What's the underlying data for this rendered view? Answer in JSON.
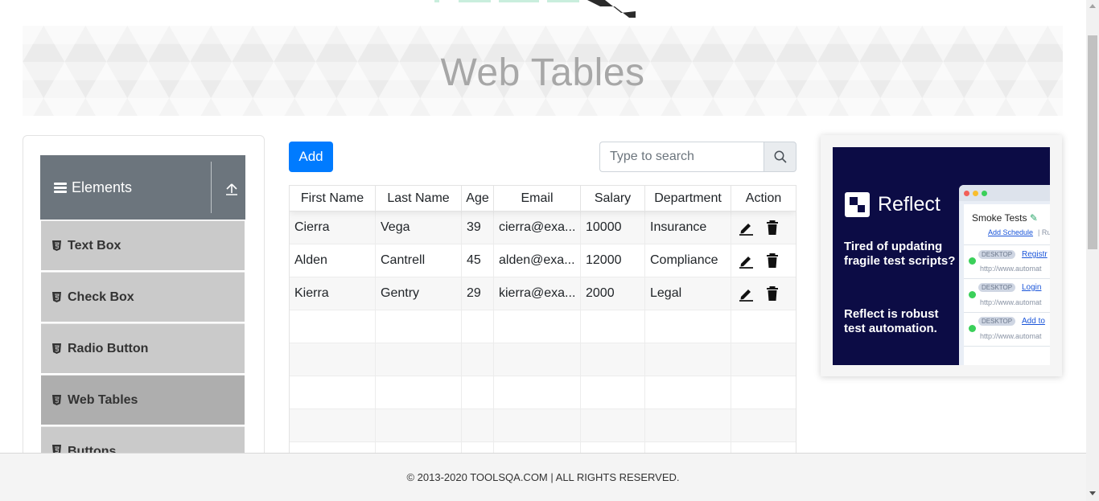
{
  "page": {
    "title": "Web Tables"
  },
  "sidebar": {
    "group_title": "Elements",
    "items": [
      {
        "label": "Text Box"
      },
      {
        "label": "Check Box"
      },
      {
        "label": "Radio Button"
      },
      {
        "label": "Web Tables",
        "active": true
      },
      {
        "label": "Buttons"
      }
    ]
  },
  "toolbar": {
    "add_label": "Add",
    "search_placeholder": "Type to search",
    "search_value": ""
  },
  "table": {
    "headers": [
      "First Name",
      "Last Name",
      "Age",
      "Email",
      "Salary",
      "Department",
      "Action"
    ],
    "rows": [
      {
        "first": "Cierra",
        "last": "Vega",
        "age": "39",
        "email": "cierra@exa...",
        "salary": "10000",
        "department": "Insurance"
      },
      {
        "first": "Alden",
        "last": "Cantrell",
        "age": "45",
        "email": "alden@exa...",
        "salary": "12000",
        "department": "Compliance"
      },
      {
        "first": "Kierra",
        "last": "Gentry",
        "age": "29",
        "email": "kierra@exa...",
        "salary": "2000",
        "department": "Legal"
      }
    ],
    "action_icons": [
      "edit-icon",
      "delete-icon"
    ]
  },
  "ad": {
    "brand": "Reflect",
    "tagline_1": "Tired of updating fragile test scripts?",
    "tagline_2": "Reflect is robust test automation.",
    "mock_title": "Smoke Tests",
    "mock_schedule": "Add Schedule",
    "mock_schedule_sep": "| Ru",
    "runs": [
      {
        "badge": "DESKTOP",
        "link": "Registr",
        "url": "http://www.automat"
      },
      {
        "badge": "DESKTOP",
        "link": "Login",
        "url": "http://www.automat"
      },
      {
        "badge": "DESKTOP",
        "link": "Add to",
        "url": "http://www.automat"
      }
    ]
  },
  "footer": {
    "text": "© 2013-2020 TOOLSQA.COM | ALL RIGHTS RESERVED."
  },
  "colors": {
    "primary": "#007bff",
    "sidebar_header": "#6c757d",
    "sidebar_item": "#cacaca",
    "sidebar_item_active": "#aeaeae",
    "ad_bg": "#0c0c45",
    "status_green": "#3bd05a"
  }
}
